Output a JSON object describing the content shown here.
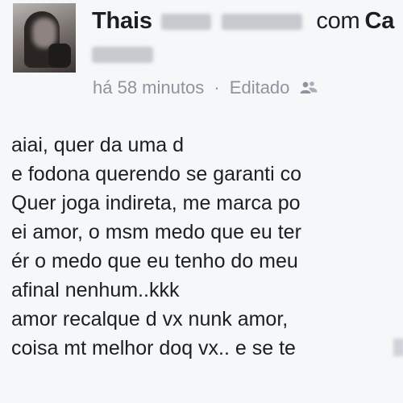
{
  "post": {
    "author_first_name": "Thais",
    "with_word": "com",
    "tagged_name_start": "Ca",
    "timestamp": "há 58 minutos",
    "separator": "·",
    "edited_label": "Editado",
    "audience_icon": "friends-icon",
    "lines": [
      "aiai, quer da uma d",
      "e fodona querendo se garanti co",
      "Quer joga indireta, me marca po",
      "ei amor, o msm medo que eu ter",
      "ér o medo que eu tenho do meu",
      "afinal nenhum..kkk",
      "amor recalque d vx nunk amor,",
      "coisa mt melhor doq vx..  e se te"
    ]
  },
  "colors": {
    "background": "#f6f7f9",
    "text": "#1c1e21",
    "meta": "#8d949e",
    "redaction": "#c7c9cf"
  }
}
